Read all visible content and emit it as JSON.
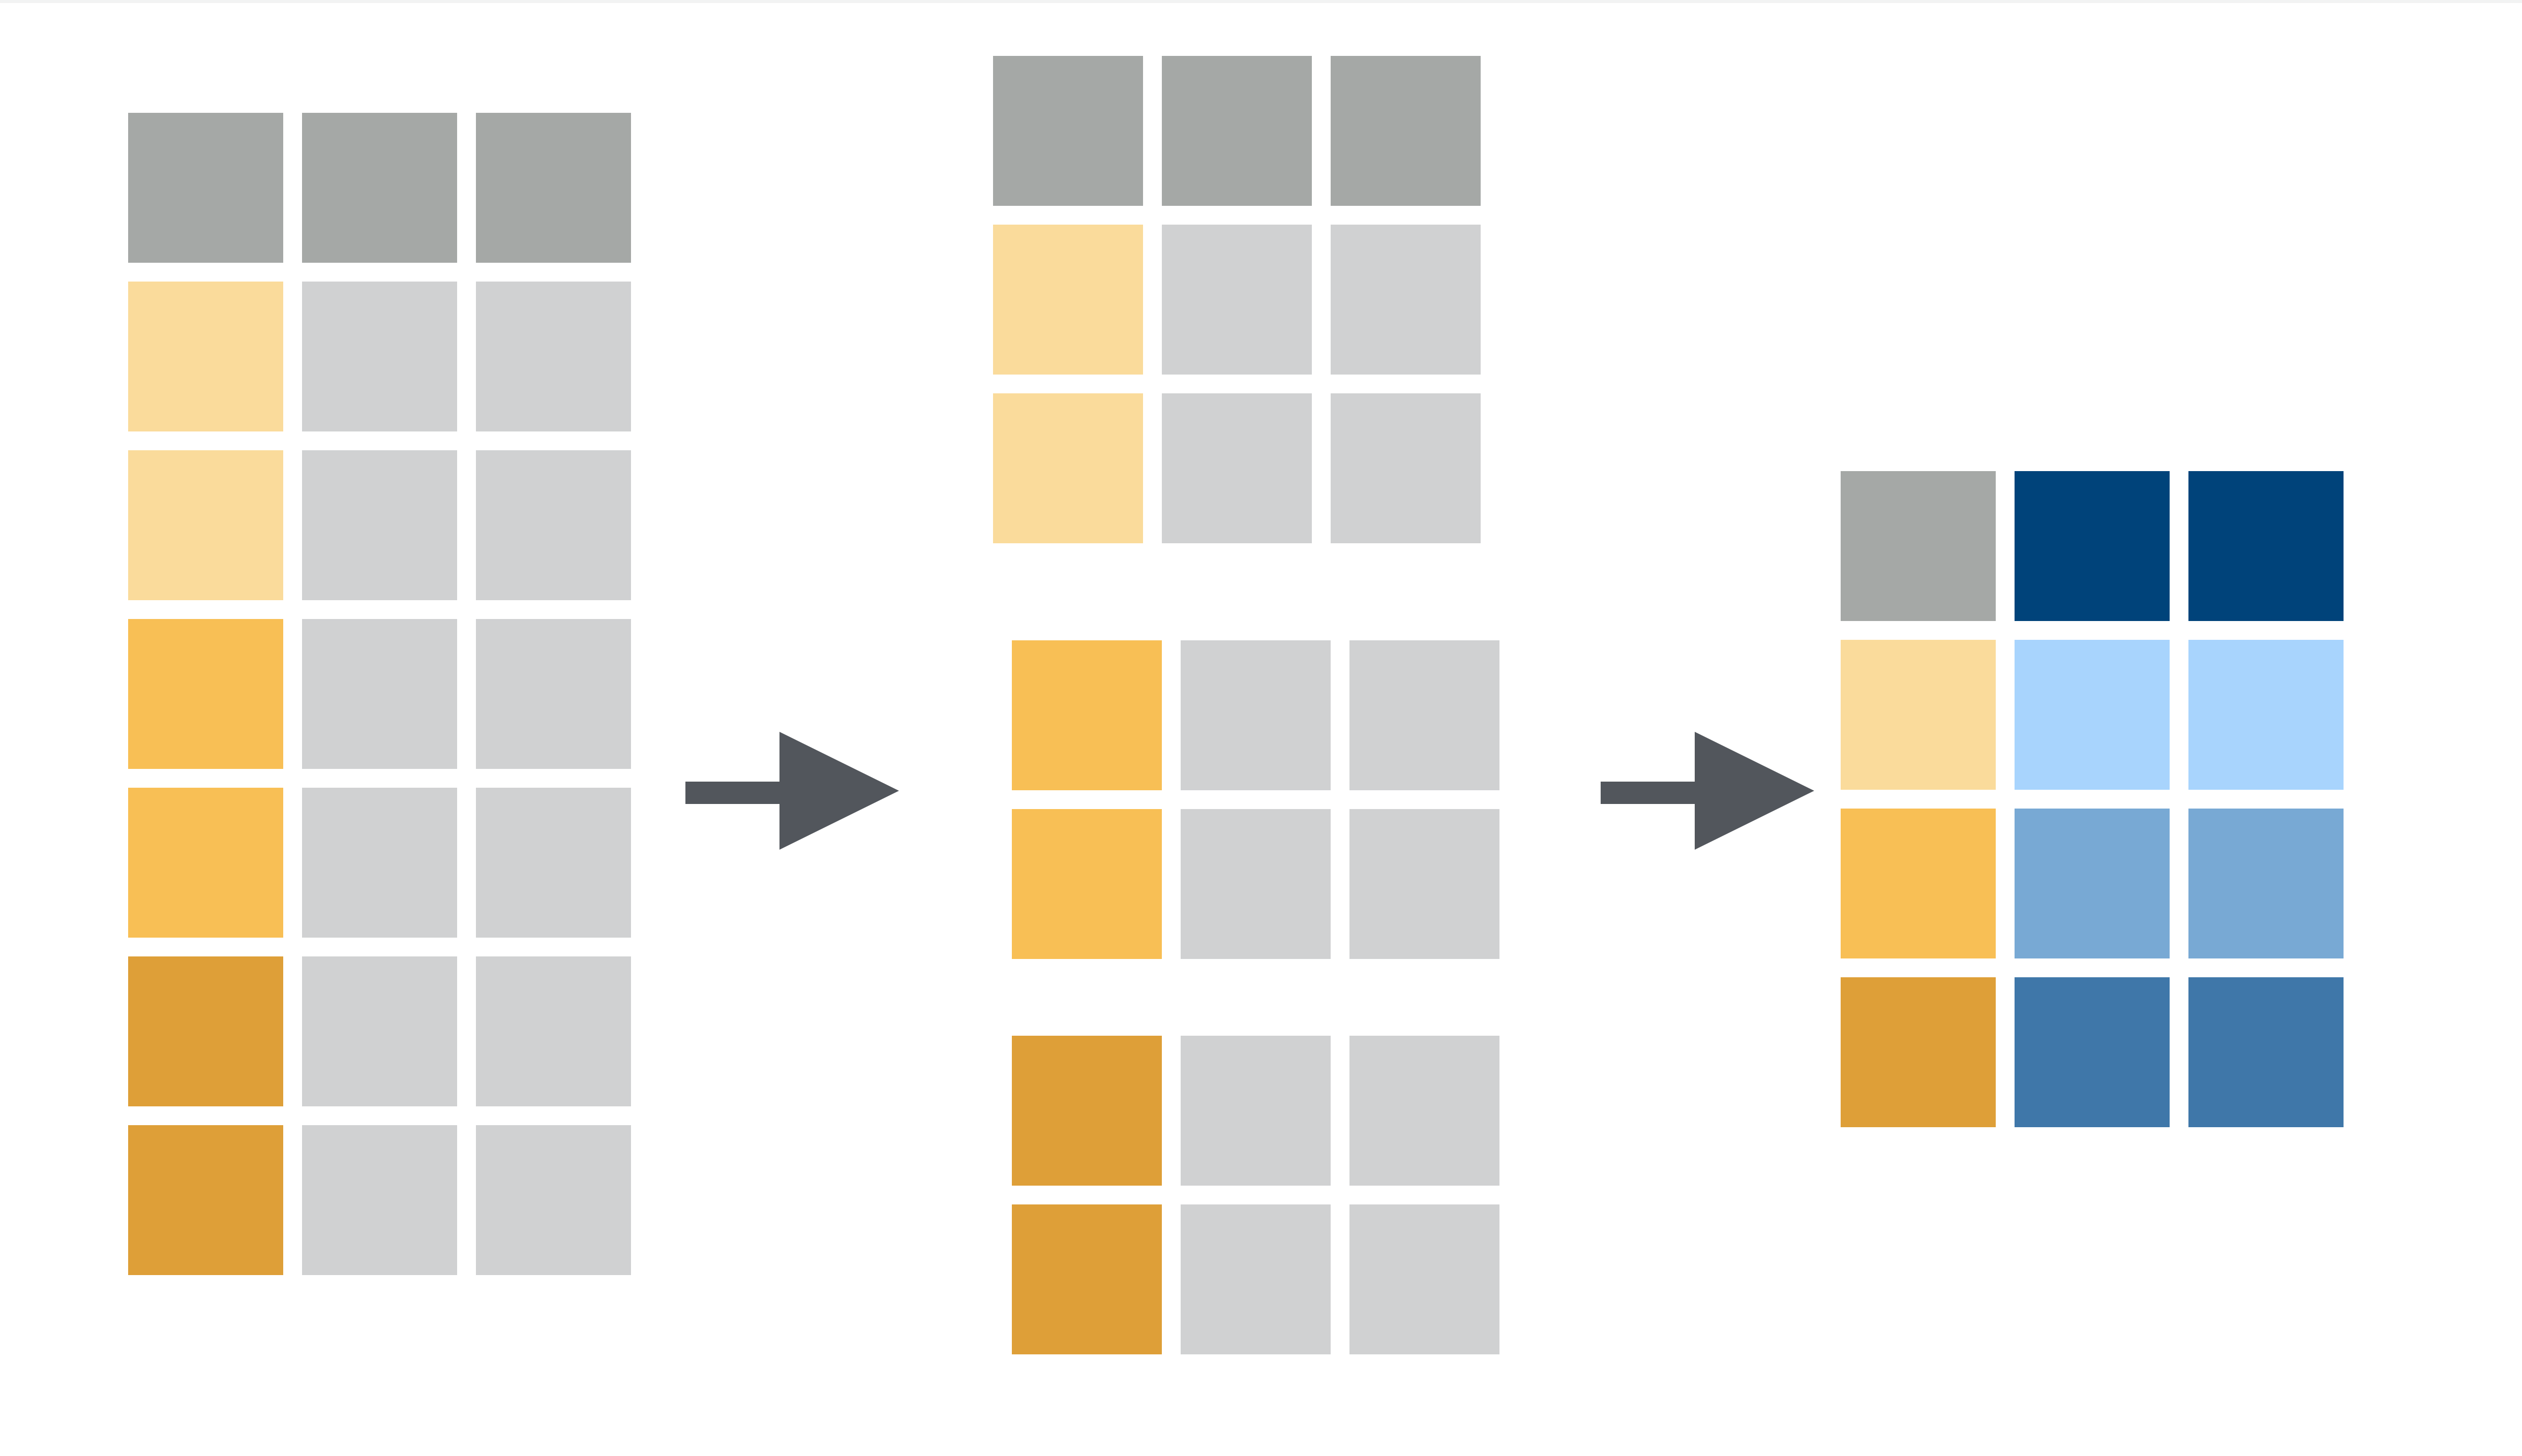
{
  "colors": {
    "header": "#a5a8a6",
    "body": "#d0d1d2",
    "light": "#fadb9b",
    "mid": "#f8bf55",
    "dark": "#de9f38",
    "summary_header": "#00437a",
    "summary_light": "#a8d4fd",
    "summary_mid": "#78a9d4",
    "summary_dark": "#3f77a9",
    "arrow": "#52565c"
  },
  "diagram": {
    "input_table": {
      "rows": [
        [
          "header",
          "header",
          "header"
        ],
        [
          "light",
          "body",
          "body"
        ],
        [
          "light",
          "body",
          "body"
        ],
        [
          "mid",
          "body",
          "body"
        ],
        [
          "mid",
          "body",
          "body"
        ],
        [
          "dark",
          "body",
          "body"
        ],
        [
          "dark",
          "body",
          "body"
        ]
      ]
    },
    "groups": [
      {
        "id": "group-light",
        "rows": [
          [
            "header",
            "header",
            "header"
          ],
          [
            "light",
            "body",
            "body"
          ],
          [
            "light",
            "body",
            "body"
          ]
        ]
      },
      {
        "id": "group-mid",
        "rows": [
          [
            "mid",
            "body",
            "body"
          ],
          [
            "mid",
            "body",
            "body"
          ]
        ]
      },
      {
        "id": "group-dark",
        "rows": [
          [
            "dark",
            "body",
            "body"
          ],
          [
            "dark",
            "body",
            "body"
          ]
        ]
      }
    ],
    "summary_table": {
      "rows": [
        [
          "header",
          "summary-header",
          "summary-header"
        ],
        [
          "light",
          "summary-light",
          "summary-light"
        ],
        [
          "mid",
          "summary-mid",
          "summary-mid"
        ],
        [
          "dark",
          "summary-dark",
          "summary-dark"
        ]
      ]
    },
    "arrows": [
      {
        "id": "arrow-split",
        "icon": "right-arrow-icon"
      },
      {
        "id": "arrow-combine",
        "icon": "right-arrow-icon"
      }
    ]
  }
}
